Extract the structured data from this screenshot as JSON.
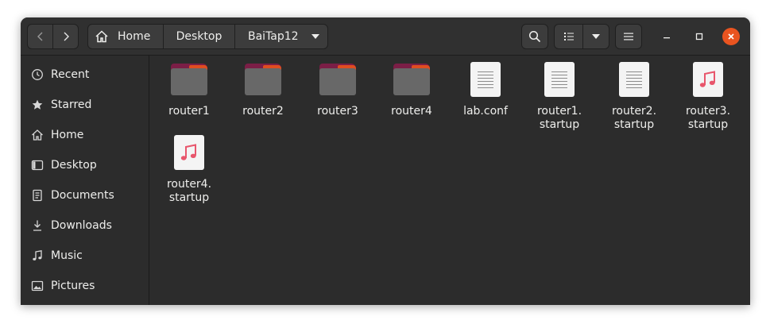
{
  "breadcrumbs": [
    "Home",
    "Desktop",
    "BaiTap12"
  ],
  "sidebar": {
    "items": [
      {
        "label": "Recent",
        "icon": "clock-icon"
      },
      {
        "label": "Starred",
        "icon": "star-icon"
      },
      {
        "label": "Home",
        "icon": "home-icon"
      },
      {
        "label": "Desktop",
        "icon": "desktop-icon"
      },
      {
        "label": "Documents",
        "icon": "documents-icon"
      },
      {
        "label": "Downloads",
        "icon": "download-icon"
      },
      {
        "label": "Music",
        "icon": "music-icon"
      },
      {
        "label": "Pictures",
        "icon": "pictures-icon"
      }
    ]
  },
  "files": [
    {
      "name": "router1",
      "type": "folder"
    },
    {
      "name": "router2",
      "type": "folder"
    },
    {
      "name": "router3",
      "type": "folder"
    },
    {
      "name": "router4",
      "type": "folder"
    },
    {
      "name": "lab.conf",
      "type": "text"
    },
    {
      "name": "router1.\nstartup",
      "type": "text"
    },
    {
      "name": "router2.\nstartup",
      "type": "text"
    },
    {
      "name": "router3.\nstartup",
      "type": "audio"
    },
    {
      "name": "router4.\nstartup",
      "type": "audio"
    }
  ],
  "colors": {
    "accent": "#e95420",
    "folder_back": "#7b1e46",
    "folder_front": "#686868",
    "music_note": "#e8566c"
  }
}
